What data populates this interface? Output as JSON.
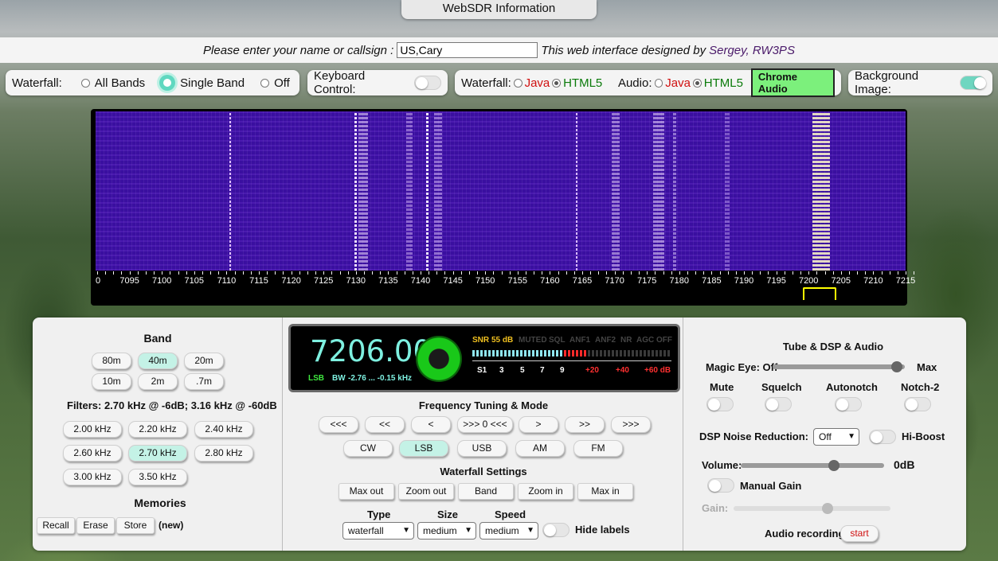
{
  "info_tab": "WebSDR Information",
  "name_bar": {
    "prompt": "Please enter your name or callsign :",
    "value": "US,Cary",
    "designed_by": "This web interface designed by",
    "author": "Sergey, RW3PS"
  },
  "waterfall_mode": {
    "label": "Waterfall:",
    "options": [
      "All Bands",
      "Single Band",
      "Off"
    ],
    "selected": "Single Band"
  },
  "keyboard": {
    "label": "Keyboard Control:"
  },
  "engine": {
    "wf_label": "Waterfall:",
    "java": "Java",
    "html5": "HTML5",
    "audio_label": "Audio:",
    "chrome": "Chrome Audio"
  },
  "background": {
    "label": "Background Image:"
  },
  "scale_labels": [
    "0",
    "7095",
    "7100",
    "7105",
    "7110",
    "7115",
    "7120",
    "7125",
    "7130",
    "7135",
    "7140",
    "7145",
    "7150",
    "7155",
    "7160",
    "7165",
    "7170",
    "7175",
    "7180",
    "7185",
    "7190",
    "7195",
    "7200",
    "7205",
    "7210",
    "7215"
  ],
  "band": {
    "title": "Band",
    "buttons": [
      "80m",
      "40m",
      "20m",
      "10m",
      "2m",
      ".7m"
    ],
    "filters_text": "Filters:  2.70 kHz @ -6dB; 3.16 kHz @ -60dB",
    "filters": [
      "2.00 kHz",
      "2.20 kHz",
      "2.40 kHz",
      "2.60 kHz",
      "2.70 kHz",
      "2.80 kHz",
      "3.00 kHz",
      "3.50 kHz"
    ],
    "memories_title": "Memories",
    "recall": "Recall",
    "erase": "Erase",
    "store": "Store",
    "new": "(new)"
  },
  "display": {
    "frequency": "7206.00",
    "mode": "LSB",
    "bw_label": "BW",
    "bw": "-2.76 ... -0.15 kHz",
    "snr_label": "SNR",
    "snr": "55 dB",
    "flags": [
      "MUTED",
      "SQL",
      "ANF1",
      "ANF2",
      "NR",
      "AGC OFF"
    ],
    "scale": [
      "S1",
      "3",
      "5",
      "7",
      "9",
      "+20",
      "+40",
      "+60 dB"
    ]
  },
  "tuning": {
    "title": "Frequency Tuning & Mode",
    "steps": [
      "<<<",
      "<<",
      "<",
      ">>> 0 <<<",
      ">",
      ">>",
      ">>>"
    ],
    "modes": [
      "CW",
      "LSB",
      "USB",
      "AM",
      "FM"
    ],
    "selected_mode": "LSB"
  },
  "wf_settings": {
    "title": "Waterfall Settings",
    "buttons": [
      "Max out",
      "Zoom out",
      "Band",
      "Zoom in",
      "Max in"
    ],
    "type_label": "Type",
    "type": "waterfall",
    "size_label": "Size",
    "size": "medium",
    "speed_label": "Speed",
    "speed": "medium",
    "hide_labels": "Hide labels"
  },
  "dsp": {
    "title": "Tube & DSP & Audio",
    "magic_eye": "Magic Eye: Off",
    "max": "Max",
    "magic_eye_level": 0.94,
    "toggles": [
      "Mute",
      "Squelch",
      "Autonotch",
      "Notch-2"
    ],
    "nr_label": "DSP Noise Reduction:",
    "nr_value": "Off",
    "hiboost": "Hi-Boost",
    "volume_label": "Volume:",
    "volume_value": "0dB",
    "volume_level": 0.65,
    "manual_gain": "Manual Gain",
    "gain_label": "Gain:",
    "gain_level": 0.6,
    "rec_label": "Audio recording:",
    "rec_button": "start"
  }
}
